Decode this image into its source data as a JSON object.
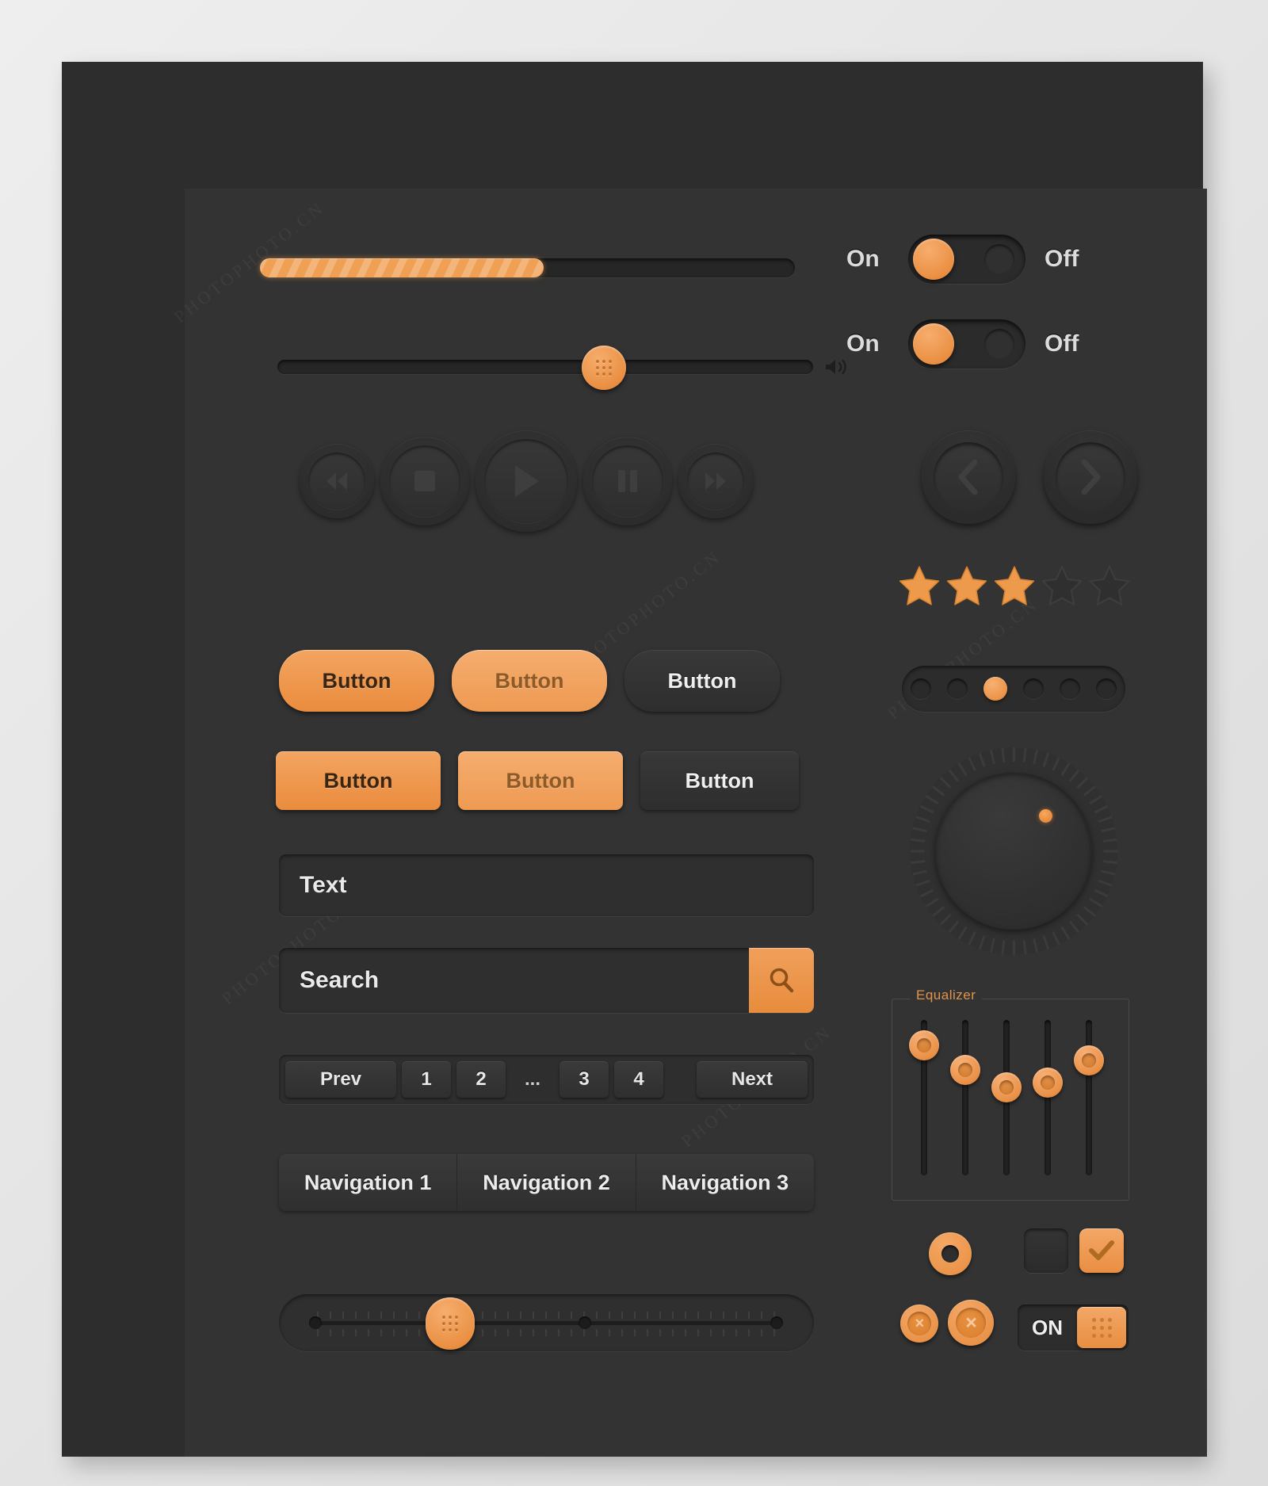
{
  "progress": {
    "name": "progress-bar",
    "value_percent": 53
  },
  "volume_slider": {
    "name": "volume-slider",
    "value_percent": 62,
    "icon": "speaker-icon"
  },
  "toggles": [
    {
      "on_label": "On",
      "off_label": "Off",
      "state": "on"
    },
    {
      "on_label": "On",
      "off_label": "Off",
      "state": "on"
    }
  ],
  "media_buttons": [
    {
      "icon": "rewind-icon",
      "label": "Rewind"
    },
    {
      "icon": "stop-icon",
      "label": "Stop"
    },
    {
      "icon": "play-icon",
      "label": "Play"
    },
    {
      "icon": "pause-icon",
      "label": "Pause"
    },
    {
      "icon": "fast-forward-icon",
      "label": "Fast Forward"
    }
  ],
  "arrow_buttons": [
    {
      "icon": "chevron-left-icon",
      "label": "Previous"
    },
    {
      "icon": "chevron-right-icon",
      "label": "Next"
    }
  ],
  "rating": {
    "total": 5,
    "filled": 3,
    "icon": "star-icon"
  },
  "dot_pager": {
    "total": 6,
    "active_index": 2
  },
  "knob": {
    "name": "rotary-knob",
    "indicator_angle_deg": 52
  },
  "buttons_row1": [
    {
      "label": "Button",
      "style": "orange-pill"
    },
    {
      "label": "Button",
      "style": "orange-pill-alt"
    },
    {
      "label": "Button",
      "style": "dark-pill"
    }
  ],
  "buttons_row2": [
    {
      "label": "Button",
      "style": "orange-rect"
    },
    {
      "label": "Button",
      "style": "orange-rect-alt"
    },
    {
      "label": "Button",
      "style": "dark-rect"
    }
  ],
  "text_input": {
    "value": "Text",
    "placeholder": "Text"
  },
  "search_input": {
    "value": "Search",
    "placeholder": "Search",
    "icon": "search-icon"
  },
  "pagination": {
    "prev_label": "Prev",
    "next_label": "Next",
    "ellipsis": "...",
    "pages_left": [
      "1",
      "2"
    ],
    "pages_right": [
      "3",
      "4"
    ]
  },
  "nav_tabs": [
    {
      "label": "Navigation 1"
    },
    {
      "label": "Navigation 2"
    },
    {
      "label": "Navigation 3"
    }
  ],
  "range_slider": {
    "name": "range-slider",
    "value_percent": 27
  },
  "equalizer": {
    "legend": "Equalizer",
    "bands": [
      {
        "value_percent": 92
      },
      {
        "value_percent": 72
      },
      {
        "value_percent": 58
      },
      {
        "value_percent": 62
      },
      {
        "value_percent": 80
      }
    ]
  },
  "form_controls": {
    "radio": {
      "name": "radio-button",
      "checked": true
    },
    "checkbox_off": {
      "name": "checkbox-unchecked",
      "checked": false
    },
    "checkbox_on": {
      "name": "checkbox-checked",
      "checked": true,
      "icon": "check-icon"
    },
    "close_small": {
      "icon": "close-icon",
      "glyph": "×"
    },
    "close_large": {
      "icon": "close-icon",
      "glyph": "×"
    },
    "on_toggle": {
      "label": "ON",
      "state": "on"
    }
  },
  "theme": {
    "accent": "#ea8f42",
    "accent_light": "#f5ad6f",
    "panel_bg": "#2d2d2d",
    "inner_bg": "#333333",
    "text": "#ececec"
  }
}
